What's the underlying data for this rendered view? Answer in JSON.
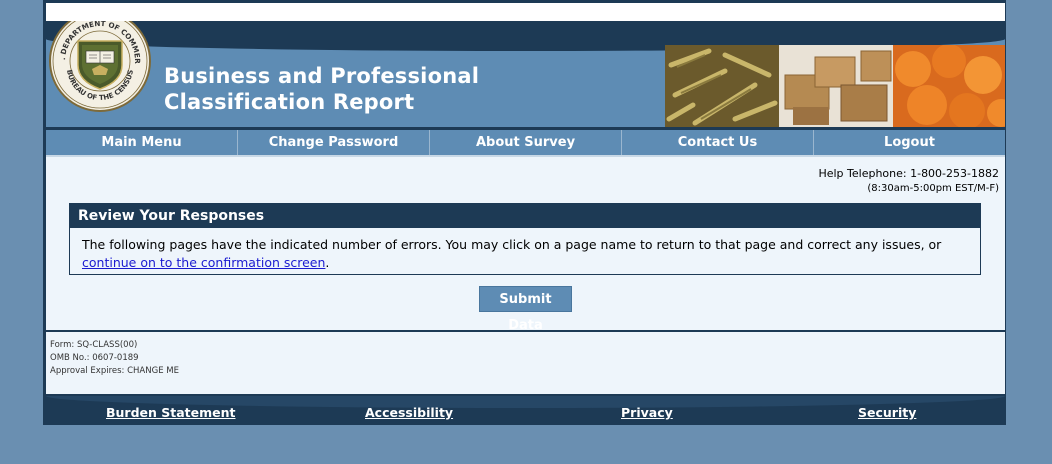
{
  "header": {
    "title_line1": "Business and Professional",
    "title_line2": "Classification Report",
    "seal_text": "U.S. DEPARTMENT OF COMMERCE · BUREAU OF THE CENSUS"
  },
  "nav": {
    "items": [
      {
        "label": "Main Menu"
      },
      {
        "label": "Change Password"
      },
      {
        "label": "About Survey"
      },
      {
        "label": "Contact Us"
      },
      {
        "label": "Logout"
      }
    ]
  },
  "help": {
    "telephone": "Help Telephone: 1-800-253-1882",
    "hours": "(8:30am-5:00pm EST/M-F)"
  },
  "review": {
    "heading": "Review Your Responses",
    "text": "The following pages have the indicated number of errors. You may click on a page name to return to that page and correct any issues, or",
    "link": "continue on to the confirmation screen",
    "link_suffix": "."
  },
  "submit_label": "Submit Data",
  "form_meta": {
    "form": "Form: SQ-CLASS(00)",
    "omb": "OMB No.: 0607-0189",
    "approval": "Approval Expires: CHANGE ME"
  },
  "footer": {
    "links": [
      {
        "label": "Burden Statement"
      },
      {
        "label": "Accessibility"
      },
      {
        "label": "Privacy"
      },
      {
        "label": "Security"
      }
    ]
  },
  "colors": {
    "background": "#6a8fb1",
    "navy": "#1d3a55",
    "banner_blue": "#5e8cb4",
    "content_bg": "#eef5fb",
    "link": "#1a1ad0"
  }
}
